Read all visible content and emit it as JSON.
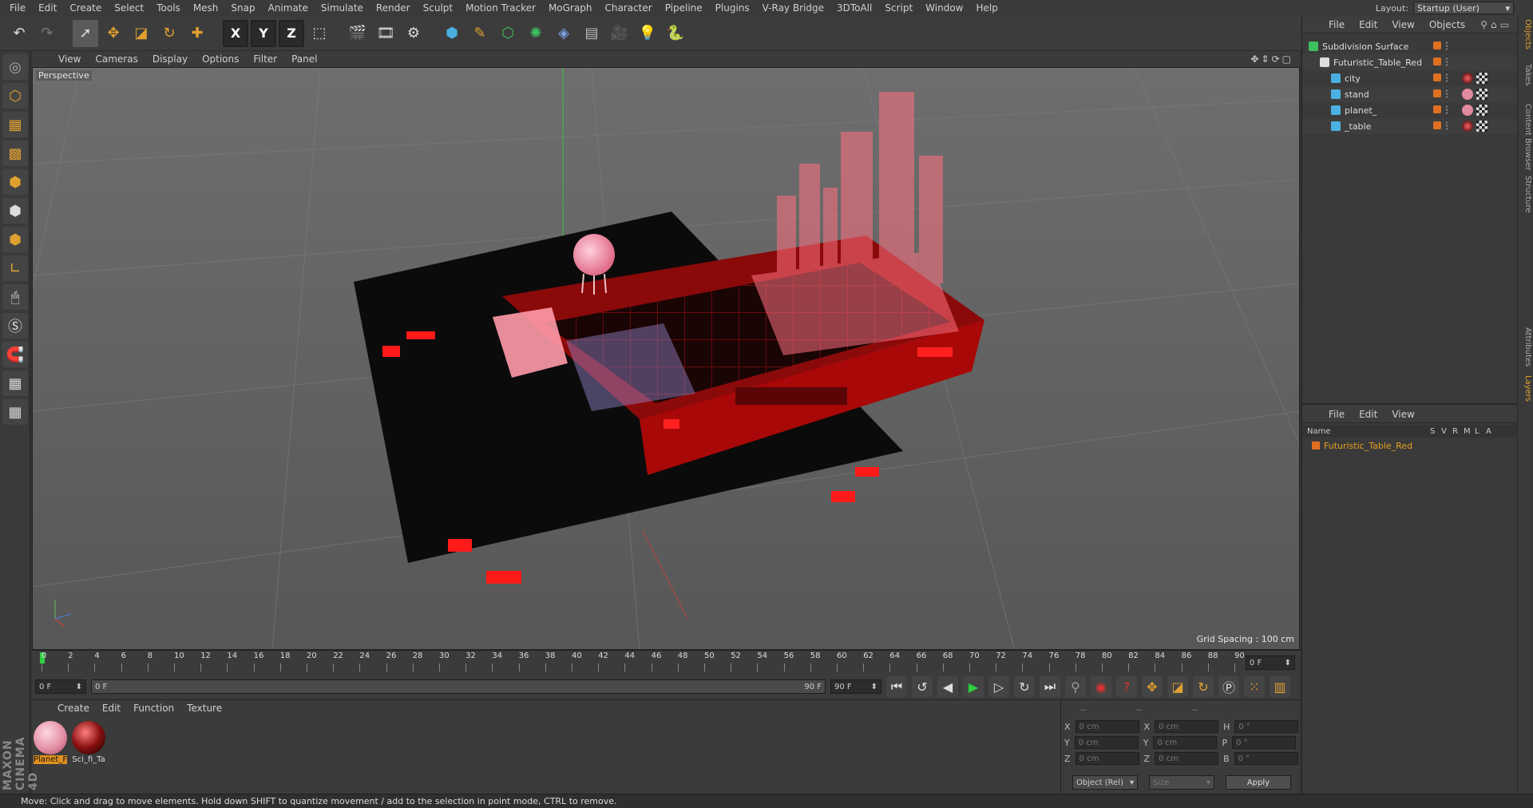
{
  "menubar": [
    "File",
    "Edit",
    "Create",
    "Select",
    "Tools",
    "Mesh",
    "Snap",
    "Animate",
    "Simulate",
    "Render",
    "Sculpt",
    "Motion Tracker",
    "MoGraph",
    "Character",
    "Pipeline",
    "Plugins",
    "V-Ray Bridge",
    "3DToAll",
    "Script",
    "Window",
    "Help"
  ],
  "layout": {
    "label": "Layout:",
    "value": "Startup (User)"
  },
  "toolbar": {
    "undo": "undo-icon",
    "redo": "redo-icon",
    "x_label": "X",
    "y_label": "Y",
    "z_label": "Z"
  },
  "viewport": {
    "menu": [
      "View",
      "Cameras",
      "Display",
      "Options",
      "Filter",
      "Panel"
    ],
    "label": "Perspective",
    "grid_spacing": "Grid Spacing : 100 cm"
  },
  "timeline": {
    "ticks": [
      "0",
      "2",
      "4",
      "6",
      "8",
      "10",
      "12",
      "14",
      "16",
      "18",
      "20",
      "22",
      "24",
      "26",
      "28",
      "30",
      "32",
      "34",
      "36",
      "38",
      "40",
      "42",
      "44",
      "46",
      "48",
      "50",
      "52",
      "54",
      "56",
      "58",
      "60",
      "62",
      "64",
      "66",
      "68",
      "70",
      "72",
      "74",
      "76",
      "78",
      "80",
      "82",
      "84",
      "86",
      "88",
      "90"
    ],
    "current_frame": "0 F"
  },
  "transport": {
    "start": "0 F",
    "range_start": "0 F",
    "range_end": "90 F",
    "end": "90 F"
  },
  "materials": {
    "menu": [
      "Create",
      "Edit",
      "Function",
      "Texture"
    ],
    "items": [
      {
        "label": "Planet_F",
        "color": "#e08aa0"
      },
      {
        "label": "Sci_fi_Ta",
        "color": "#8a1010"
      }
    ]
  },
  "coordinates": {
    "headers": [
      "--",
      "--",
      "--"
    ],
    "rows": [
      {
        "a": "X",
        "av": "0 cm",
        "b": "X",
        "bv": "0 cm",
        "c": "H",
        "cv": "0 °"
      },
      {
        "a": "Y",
        "av": "0 cm",
        "b": "Y",
        "bv": "0 cm",
        "c": "P",
        "cv": "0 °"
      },
      {
        "a": "Z",
        "av": "0 cm",
        "b": "Z",
        "bv": "0 cm",
        "c": "B",
        "cv": "0 °"
      }
    ],
    "mode": "Object (Rel)",
    "size": "Size",
    "apply": "Apply"
  },
  "objects_panel": {
    "menu": [
      "File",
      "Edit",
      "View",
      "Objects"
    ],
    "items": [
      {
        "name": "Subdivision Surface",
        "indent": 0
      },
      {
        "name": "Futuristic_Table_Red",
        "indent": 1
      },
      {
        "name": "city",
        "indent": 2
      },
      {
        "name": "stand",
        "indent": 2
      },
      {
        "name": "planet_",
        "indent": 2
      },
      {
        "name": "_table",
        "indent": 2
      }
    ]
  },
  "layers_panel": {
    "menu": [
      "File",
      "Edit",
      "View"
    ],
    "columns": [
      "Name",
      "S",
      "V",
      "R",
      "M",
      "L",
      "A"
    ],
    "item": "Futuristic_Table_Red"
  },
  "side_tabs": [
    "Objects",
    "Takes",
    "Content Browser",
    "Structure",
    "Attributes",
    "Layers"
  ],
  "status": "Move: Click and drag to move elements. Hold down SHIFT to quantize movement / add to the selection in point mode, CTRL to remove.",
  "brand": "MAXON CINEMA 4D",
  "colors": {
    "accent": "#e0a030",
    "object_orange": "#e07020",
    "table_red": "#c01010"
  }
}
